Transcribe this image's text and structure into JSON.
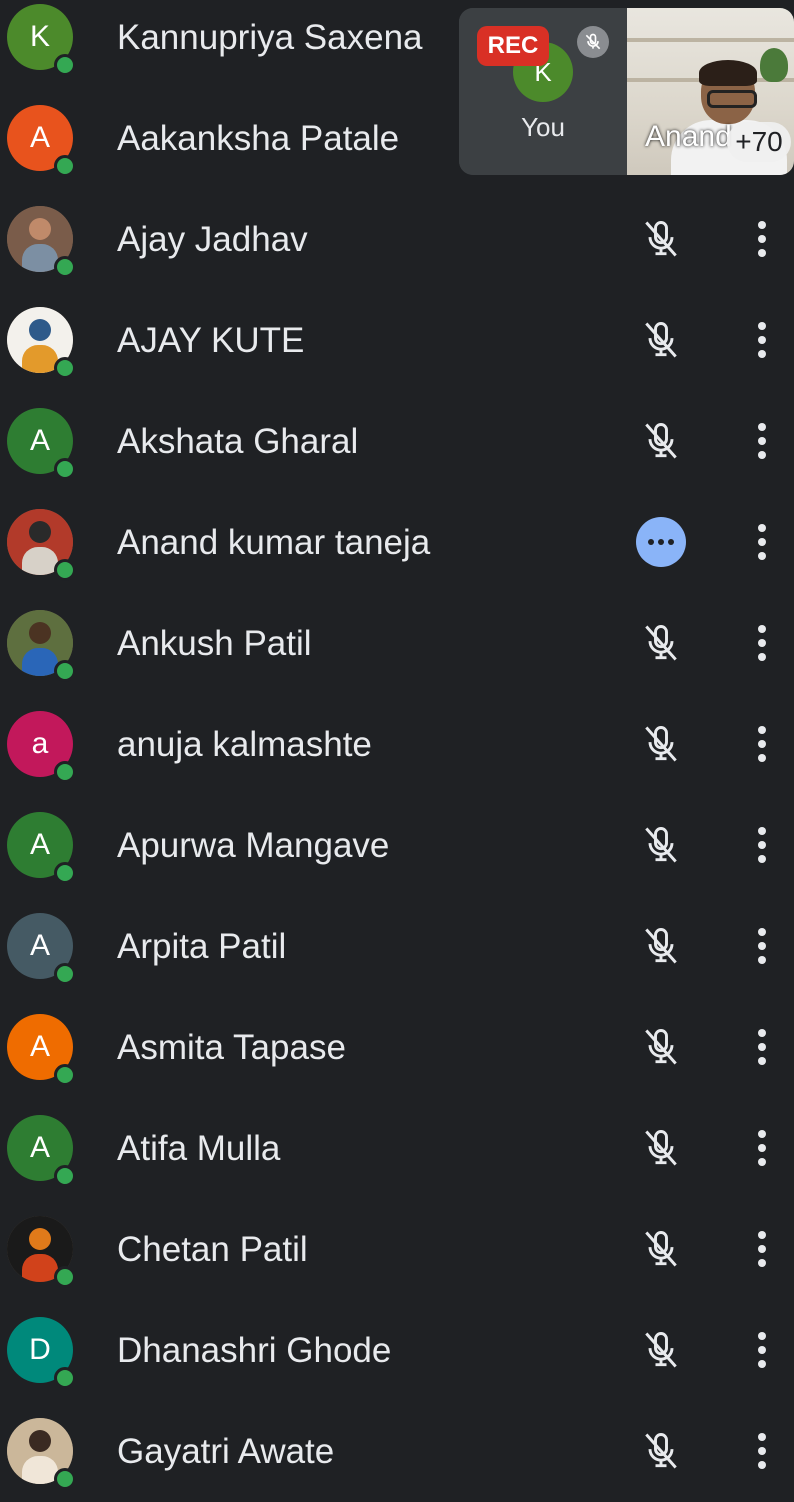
{
  "pip": {
    "rec_label": "REC",
    "you_initial": "K",
    "you_label": "You",
    "anand_label": "Anand",
    "more_count": "+70"
  },
  "participants": [
    {
      "name": "Kannupriya Saxena",
      "initial": "K",
      "color": "#4c8a2b",
      "status": "none"
    },
    {
      "name": "Aakanksha Patale",
      "initial": "A",
      "color": "#e8531d",
      "status": "none"
    },
    {
      "name": "Ajay Jadhav",
      "initial": "",
      "photo": true,
      "status": "muted"
    },
    {
      "name": "AJAY KUTE",
      "initial": "",
      "photo": true,
      "status": "muted"
    },
    {
      "name": "Akshata Gharal",
      "initial": "A",
      "color": "#2e7d32",
      "status": "muted"
    },
    {
      "name": "Anand kumar taneja",
      "initial": "",
      "photo": true,
      "status": "speaking"
    },
    {
      "name": "Ankush Patil",
      "initial": "",
      "photo": true,
      "status": "muted"
    },
    {
      "name": "anuja kalmashte",
      "initial": "a",
      "color": "#c2185b",
      "status": "muted"
    },
    {
      "name": "Apurwa Mangave",
      "initial": "A",
      "color": "#2e7d32",
      "status": "muted"
    },
    {
      "name": "Arpita Patil",
      "initial": "A",
      "color": "#455a64",
      "status": "muted"
    },
    {
      "name": "Asmita Tapase",
      "initial": "A",
      "color": "#ef6c00",
      "status": "muted"
    },
    {
      "name": "Atifa Mulla",
      "initial": "A",
      "color": "#2e7d32",
      "status": "muted"
    },
    {
      "name": "Chetan Patil",
      "initial": "",
      "photo": true,
      "status": "muted"
    },
    {
      "name": "Dhanashri Ghode",
      "initial": "D",
      "color": "#00897b",
      "status": "muted"
    },
    {
      "name": "Gayatri Awate",
      "initial": "",
      "photo": true,
      "status": "muted"
    }
  ]
}
